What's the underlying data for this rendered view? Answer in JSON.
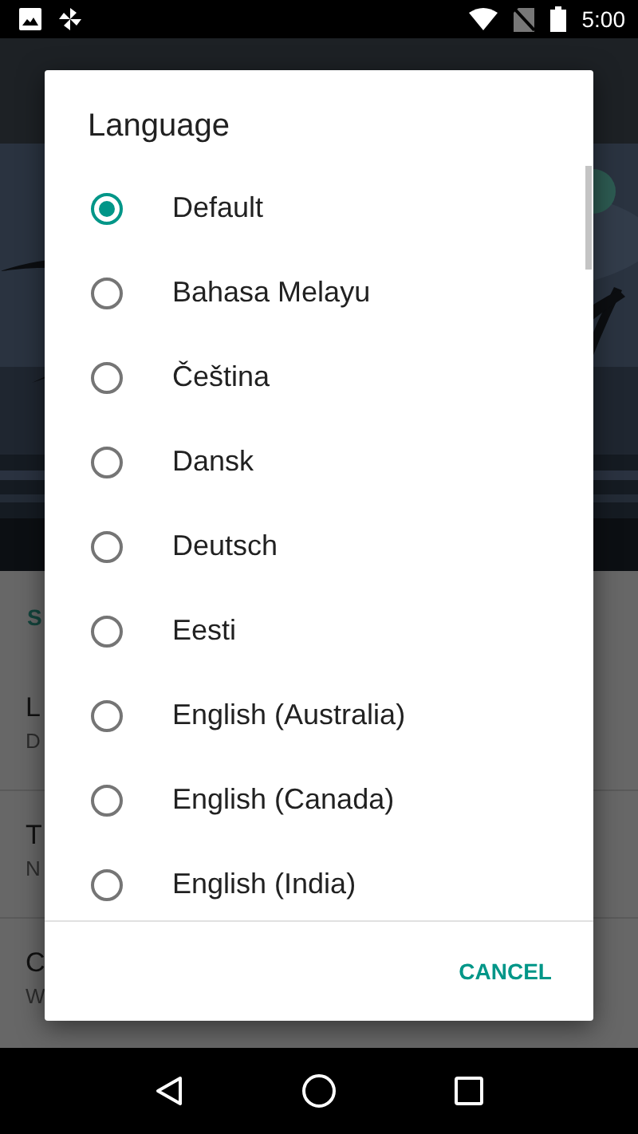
{
  "status_bar": {
    "time": "5:00"
  },
  "background": {
    "section_header": "S",
    "rows": [
      {
        "title": "L",
        "subtitle": "D"
      },
      {
        "title": "T",
        "subtitle": "N"
      },
      {
        "title": "C",
        "subtitle": "W"
      }
    ]
  },
  "dialog": {
    "title": "Language",
    "options": [
      {
        "label": "Default",
        "selected": true
      },
      {
        "label": "Bahasa Melayu",
        "selected": false
      },
      {
        "label": "Čeština",
        "selected": false
      },
      {
        "label": "Dansk",
        "selected": false
      },
      {
        "label": "Deutsch",
        "selected": false
      },
      {
        "label": "Eesti",
        "selected": false
      },
      {
        "label": "English (Australia)",
        "selected": false
      },
      {
        "label": "English (Canada)",
        "selected": false
      },
      {
        "label": "English (India)",
        "selected": false
      }
    ],
    "buttons": [
      "CANCEL"
    ]
  }
}
